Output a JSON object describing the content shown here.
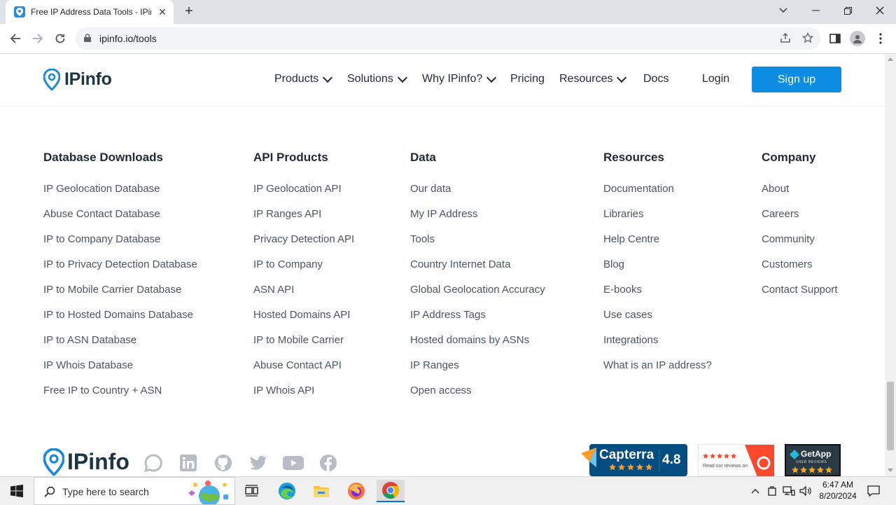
{
  "browser": {
    "tab_title": "Free IP Address Data Tools - IPinfo",
    "tab_close": "✕",
    "new_tab": "+",
    "url": "ipinfo.io/tools"
  },
  "header": {
    "logo_text": "IPinfo",
    "nav": [
      "Products",
      "Solutions",
      "Why IPinfo?",
      "Pricing",
      "Resources",
      "Docs"
    ],
    "login": "Login",
    "signup": "Sign up"
  },
  "footer": {
    "columns": [
      {
        "title": "Database Downloads",
        "links": [
          "IP Geolocation Database",
          "Abuse Contact Database",
          "IP to Company Database",
          "IP to Privacy Detection Database",
          "IP to Mobile Carrier Database",
          "IP to Hosted Domains Database",
          "IP to ASN Database",
          "IP Whois Database",
          "Free IP to Country + ASN"
        ]
      },
      {
        "title": "API Products",
        "links": [
          "IP Geolocation API",
          "IP Ranges API",
          "Privacy Detection API",
          "IP to Company",
          "ASN API",
          "Hosted Domains API",
          "IP to Mobile Carrier",
          "Abuse Contact API",
          "IP Whois API"
        ]
      },
      {
        "title": "Data",
        "links": [
          "Our data",
          "My IP Address",
          "Tools",
          "Country Internet Data",
          "Global Geolocation Accuracy",
          "IP Address Tags",
          "Hosted domains by ASNs",
          "IP Ranges",
          "Open access"
        ]
      },
      {
        "title": "Resources",
        "links": [
          "Documentation",
          "Libraries",
          "Help Centre",
          "Blog",
          "E-books",
          "Use cases",
          "Integrations",
          "What is an IP address?"
        ]
      },
      {
        "title": "Company",
        "links": [
          "About",
          "Careers",
          "Community",
          "Customers",
          "Contact Support"
        ]
      }
    ],
    "logo_text": "IPinfo",
    "social_icons": [
      "chat-icon",
      "linkedin-icon",
      "github-icon",
      "twitter-icon",
      "youtube-icon",
      "facebook-icon"
    ],
    "capterra": {
      "name": "Capterra",
      "score": "4.8"
    },
    "g2": {
      "text": "Read our reviews on"
    },
    "getapp": {
      "name": "GetApp",
      "sub": "USER REVIEWS"
    }
  },
  "taskbar": {
    "search_placeholder": "Type here to search",
    "time": "6:47 AM",
    "date": "8/20/2024"
  },
  "colors": {
    "accent": "#0c8de1",
    "brand_dark": "#1d3445"
  }
}
